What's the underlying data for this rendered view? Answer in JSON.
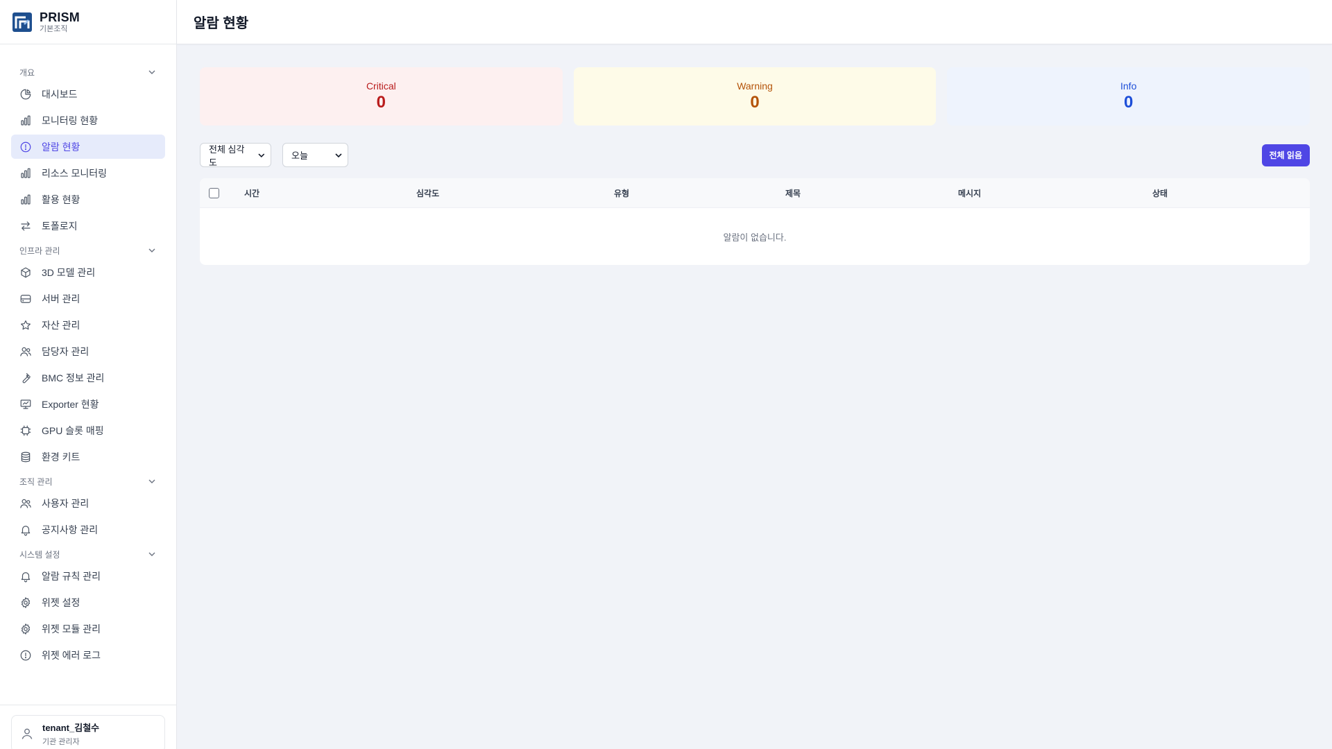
{
  "brand": {
    "name": "PRISM",
    "sub": "기본조직"
  },
  "page_title": "알람 현황",
  "sidebar": {
    "sections": [
      {
        "title": "개요",
        "items": [
          {
            "label": "대시보드",
            "icon": "pie-chart-icon"
          },
          {
            "label": "모니터링 현황",
            "icon": "bar-chart-icon"
          },
          {
            "label": "알람 현황",
            "icon": "alert-circle-icon",
            "active": true
          },
          {
            "label": "리소스 모니터링",
            "icon": "bar-chart-icon"
          },
          {
            "label": "활용 현황",
            "icon": "bar-chart-icon"
          },
          {
            "label": "토폴로지",
            "icon": "swap-arrows-icon"
          }
        ]
      },
      {
        "title": "인프라 관리",
        "items": [
          {
            "label": "3D 모델 관리",
            "icon": "cube-icon"
          },
          {
            "label": "서버 관리",
            "icon": "server-icon"
          },
          {
            "label": "자산 관리",
            "icon": "star-icon"
          },
          {
            "label": "담당자 관리",
            "icon": "users-icon"
          },
          {
            "label": "BMC 정보 관리",
            "icon": "wrench-icon"
          },
          {
            "label": "Exporter 현황",
            "icon": "presentation-chart-icon"
          },
          {
            "label": "GPU 슬롯 매핑",
            "icon": "chip-icon"
          },
          {
            "label": "환경 키트",
            "icon": "database-icon"
          }
        ]
      },
      {
        "title": "조직 관리",
        "items": [
          {
            "label": "사용자 관리",
            "icon": "users-icon"
          },
          {
            "label": "공지사항 관리",
            "icon": "bell-icon"
          }
        ]
      },
      {
        "title": "시스템 설정",
        "items": [
          {
            "label": "알람 규칙 관리",
            "icon": "bell-icon"
          },
          {
            "label": "위젯 설정",
            "icon": "gear-icon"
          },
          {
            "label": "위젯 모듈 관리",
            "icon": "gear-icon"
          },
          {
            "label": "위젯 에러 로그",
            "icon": "alert-circle-icon"
          }
        ]
      }
    ]
  },
  "user": {
    "name": "tenant_김철수",
    "role": "기관 관리자"
  },
  "stats": {
    "critical": {
      "label": "Critical",
      "value": "0"
    },
    "warning": {
      "label": "Warning",
      "value": "0"
    },
    "info": {
      "label": "Info",
      "value": "0"
    }
  },
  "filters": {
    "severity": "전체 심각도",
    "period": "오늘",
    "read_all": "전체 읽음"
  },
  "table": {
    "columns": [
      "시간",
      "심각도",
      "유형",
      "제목",
      "메시지",
      "상태"
    ],
    "empty_text": "알람이 없습니다."
  },
  "colors": {
    "accent": "#4f46e5",
    "critical": "#b91c1c",
    "warning": "#b45309",
    "info": "#1d4ed8"
  }
}
